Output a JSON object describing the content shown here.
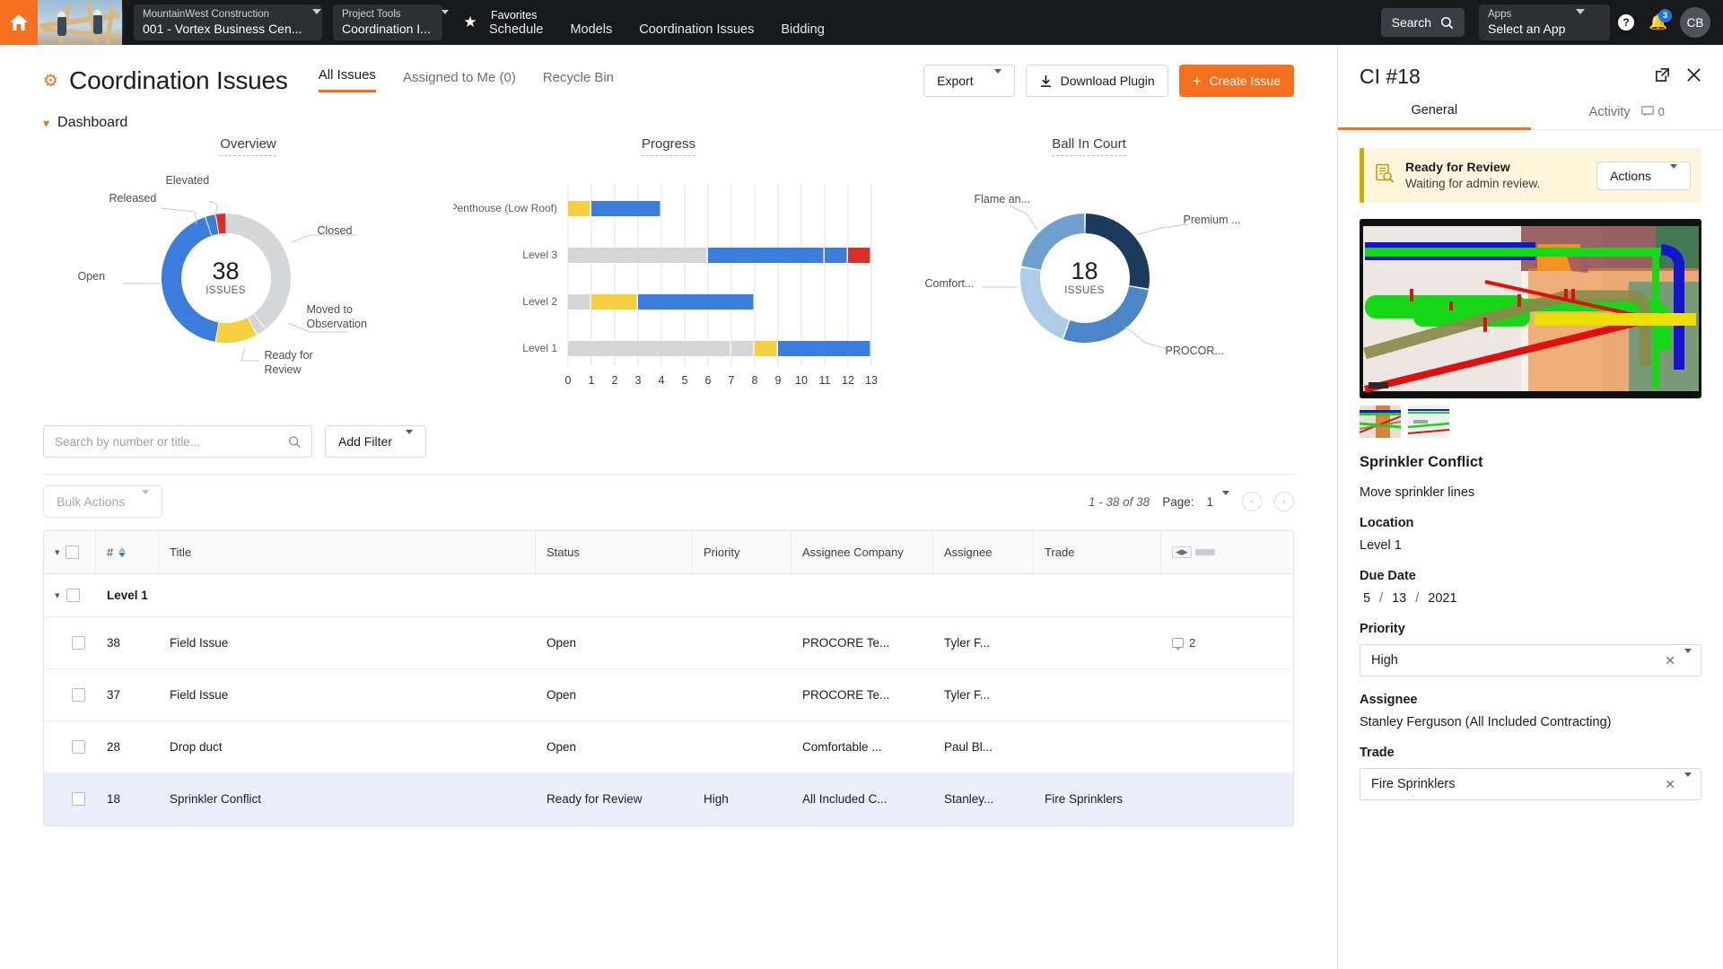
{
  "topnav": {
    "home_icon": "home-icon",
    "company_label": "MountainWest Construction",
    "company_value": "001 - Vortex Business Cen...",
    "tool_label": "Project Tools",
    "tool_value": "Coordination I...",
    "favorites_label": "Favorites",
    "links": [
      "Schedule",
      "Models",
      "Coordination Issues",
      "Bidding"
    ],
    "search_label": "Search",
    "apps_label": "Apps",
    "apps_value": "Select an App",
    "notification_count": "3",
    "avatar_initials": "CB"
  },
  "page": {
    "title": "Coordination Issues",
    "tabs": [
      {
        "label": "All Issues",
        "active": true
      },
      {
        "label": "Assigned to Me (0)",
        "active": false
      },
      {
        "label": "Recycle Bin",
        "active": false
      }
    ],
    "export_label": "Export",
    "download_plugin_label": "Download Plugin",
    "create_issue_label": "Create Issue",
    "create_issue_plus": "+",
    "dashboard_label": "Dashboard"
  },
  "chart_data": [
    {
      "type": "pie",
      "title": "Overview",
      "center_value": "38",
      "center_label": "ISSUES",
      "total": 38,
      "labels": [
        "Closed",
        "Moved to\nObservation",
        "Ready for\nReview",
        "Open",
        "Released",
        "Elevated"
      ],
      "values": [
        15,
        1,
        4,
        16,
        1,
        1
      ],
      "colors": [
        "#d4d6d8",
        "#d4d6d8",
        "#f6cf3e",
        "#3b7ddd",
        "#3b7ddd",
        "#d93025"
      ],
      "legend": "callout"
    },
    {
      "type": "bar",
      "title": "Progress",
      "orientation": "horizontal",
      "categories": [
        "Penthouse (Low Roof)",
        "Level 3",
        "Level 2",
        "Level 1"
      ],
      "xlabel": "",
      "ylabel": "",
      "xlim": [
        0,
        13
      ],
      "xticks": [
        "0",
        "1",
        "2",
        "3",
        "4",
        "5",
        "6",
        "7",
        "8",
        "9",
        "10",
        "11",
        "12",
        "13"
      ],
      "grid": true,
      "stacks": [
        [
          {
            "color": "#f6cf3e",
            "from": 0,
            "to": 1
          },
          {
            "color": "#3b7ddd",
            "from": 1,
            "to": 4
          }
        ],
        [
          {
            "color": "#d4d6d8",
            "from": 0,
            "to": 6
          },
          {
            "color": "#3b7ddd",
            "from": 6,
            "to": 11
          },
          {
            "color": "#3b7ddd",
            "from": 11,
            "to": 12
          },
          {
            "color": "#d93025",
            "from": 12,
            "to": 13
          }
        ],
        [
          {
            "color": "#d4d6d8",
            "from": 0,
            "to": 1
          },
          {
            "color": "#f6cf3e",
            "from": 1,
            "to": 3
          },
          {
            "color": "#3b7ddd",
            "from": 3,
            "to": 8
          }
        ],
        [
          {
            "color": "#d4d6d8",
            "from": 0,
            "to": 7
          },
          {
            "color": "#d4d6d8",
            "from": 7,
            "to": 8
          },
          {
            "color": "#f6cf3e",
            "from": 8,
            "to": 9
          },
          {
            "color": "#3b7ddd",
            "from": 9,
            "to": 13
          }
        ]
      ]
    },
    {
      "type": "pie",
      "title": "Ball In Court",
      "center_value": "18",
      "center_label": "ISSUES",
      "total": 18,
      "labels": [
        "Premium ...",
        "PROCOR...",
        "Comfort...",
        "Flame an..."
      ],
      "values": [
        5,
        5,
        4,
        4
      ],
      "colors": [
        "#1b3a5c",
        "#4a86c8",
        "#aecbe8",
        "#6ea0cf"
      ],
      "legend": "callout"
    }
  ],
  "filters": {
    "search_placeholder": "Search by number or title...",
    "search_value": "",
    "add_filter_label": "Add Filter",
    "bulk_actions_label": "Bulk Actions",
    "range_text": "1 - 38 of 38",
    "page_label": "Page:",
    "page_value": "1"
  },
  "table": {
    "columns": [
      "#",
      "Title",
      "Status",
      "Priority",
      "Assignee Company",
      "Assignee",
      "Trade"
    ],
    "group_label": "Level 1",
    "rows": [
      {
        "num": "38",
        "title": "Field Issue",
        "status": "Open",
        "priority": "",
        "company": "PROCORE Te...",
        "assignee": "Tyler F...",
        "trade": "",
        "comments": "2",
        "selected": false
      },
      {
        "num": "37",
        "title": "Field Issue",
        "status": "Open",
        "priority": "",
        "company": "PROCORE Te...",
        "assignee": "Tyler F...",
        "trade": "",
        "comments": "",
        "selected": false
      },
      {
        "num": "28",
        "title": "Drop duct",
        "status": "Open",
        "priority": "",
        "company": "Comfortable ...",
        "assignee": "Paul Bl...",
        "trade": "",
        "comments": "",
        "selected": false
      },
      {
        "num": "18",
        "title": "Sprinkler Conflict",
        "status": "Ready for Review",
        "priority": "High",
        "company": "All Included C...",
        "assignee": "Stanley...",
        "trade": "Fire Sprinklers",
        "comments": "",
        "selected": true
      }
    ]
  },
  "panel": {
    "title": "CI #18",
    "tabs": [
      {
        "label": "General",
        "count": "",
        "active": true
      },
      {
        "label": "Activity",
        "count": "0",
        "active": false
      }
    ],
    "alert_title": "Ready for Review",
    "alert_subtitle": "Waiting for admin review.",
    "actions_label": "Actions",
    "issue_title": "Sprinkler Conflict",
    "issue_description": "Move sprinkler lines",
    "location_label": "Location",
    "location_value": "Level 1",
    "due_date_label": "Due Date",
    "due_month": "5",
    "due_day": "13",
    "due_year": "2021",
    "priority_label": "Priority",
    "priority_value": "High",
    "assignee_label": "Assignee",
    "assignee_value": "Stanley Ferguson (All Included Contracting)",
    "trade_label": "Trade",
    "trade_value": "Fire Sprinklers"
  },
  "colors": {
    "brand_orange": "#f4701f",
    "blue": "#3b7ddd",
    "yellow": "#f6cf3e",
    "gray": "#d4d6d8",
    "red": "#d93025",
    "selected_row": "#e9f0fb"
  }
}
